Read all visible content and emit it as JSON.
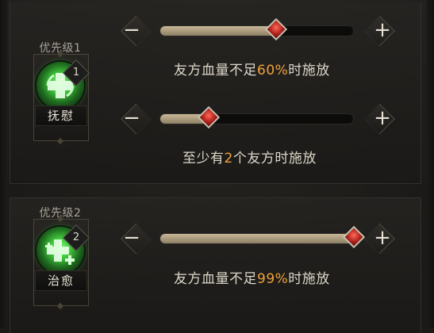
{
  "colors": {
    "highlight_number": "#f0a23a",
    "text": "#ddd7c9",
    "thumb": "#d4302a",
    "fill": "#b8a684"
  },
  "skills": [
    {
      "priority_label": "优先级1",
      "badge": "1",
      "name": "抚慰",
      "icon": "heal-cross-icon",
      "sliders": [
        {
          "minus_label": "−",
          "plus_label": "+",
          "value_fraction": 0.6,
          "condition_pre": "友方血量不足",
          "condition_value": "60%",
          "condition_post": "时施放"
        },
        {
          "minus_label": "−",
          "plus_label": "+",
          "value_fraction": 0.25,
          "condition_pre": "至少有",
          "condition_value": "2",
          "condition_post": "个友方时施放"
        }
      ]
    },
    {
      "priority_label": "优先级2",
      "badge": "2",
      "name": "治愈",
      "icon": "heal-plus-icon",
      "sliders": [
        {
          "minus_label": "−",
          "plus_label": "+",
          "value_fraction": 0.99,
          "condition_pre": "友方血量不足",
          "condition_value": "99%",
          "condition_post": "时施放"
        }
      ]
    }
  ]
}
